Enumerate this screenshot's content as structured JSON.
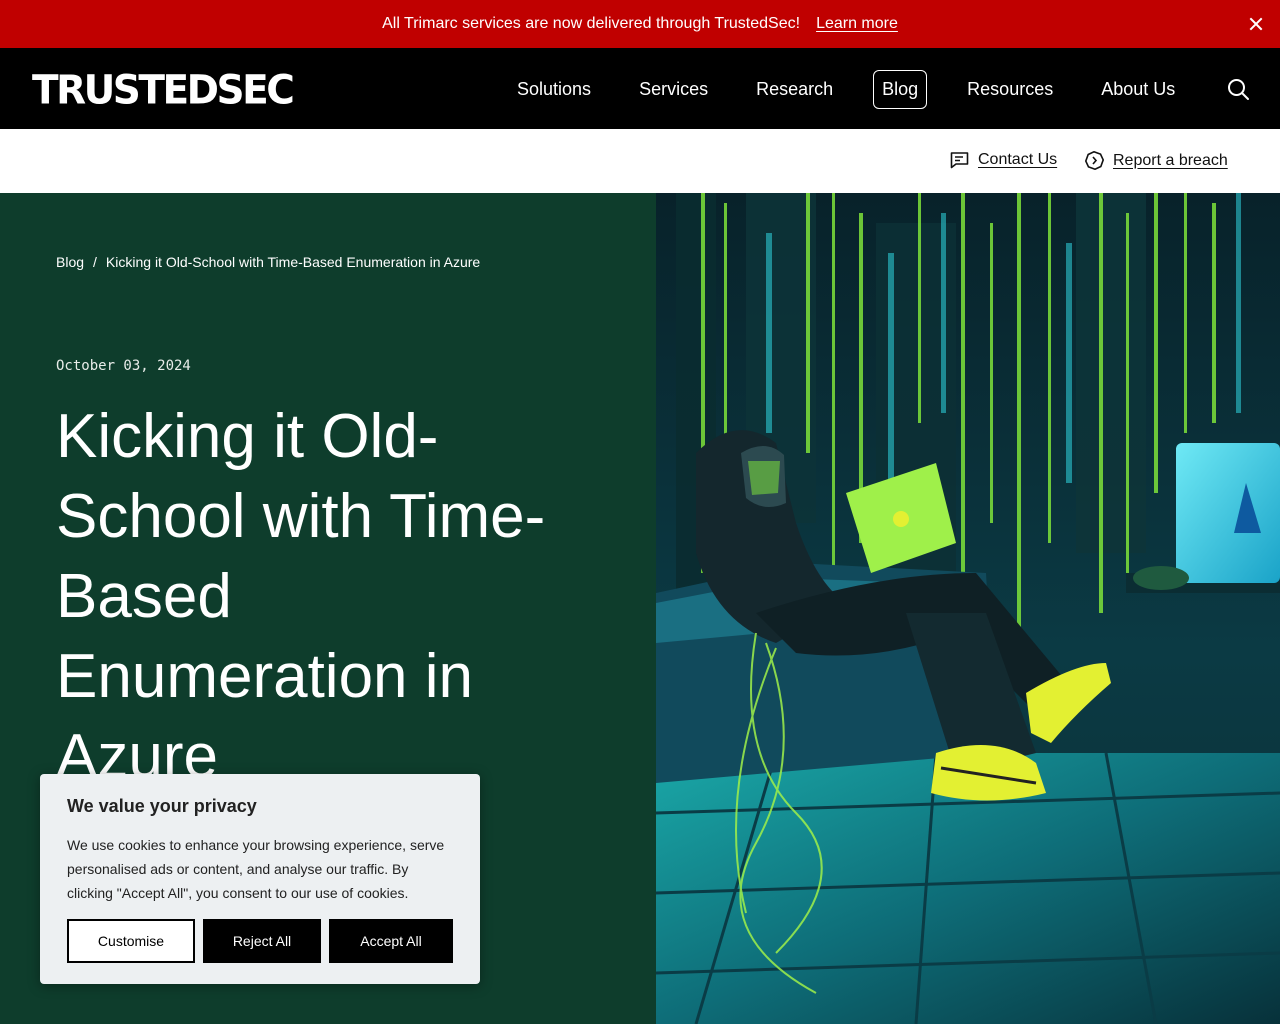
{
  "announcement": {
    "message": "All Trimarc services are now delivered through TrustedSec!",
    "link_label": "Learn more"
  },
  "header": {
    "logo_text": "TRUSTEDSEC",
    "nav": [
      "Solutions",
      "Services",
      "Research",
      "Blog",
      "Resources",
      "About Us"
    ],
    "active_nav": "Blog"
  },
  "subbar": {
    "contact_label": "Contact Us",
    "breach_label": "Report a breach"
  },
  "hero": {
    "breadcrumb_root": "Blog",
    "breadcrumb_sep": "/",
    "breadcrumb_current": "Kicking it Old-School with Time-Based Enumeration in Azure",
    "date": "October 03, 2024",
    "title": "Kicking it Old-School with Time-Based Enumeration in Azure"
  },
  "cookie": {
    "heading": "We value your privacy",
    "body": "We use cookies to enhance your browsing experience, serve personalised ads or content, and analyse our traffic. By clicking \"Accept All\", you consent to our use of cookies.",
    "customise_label": "Customise",
    "reject_label": "Reject All",
    "accept_label": "Accept All"
  },
  "colors": {
    "announcement_bg": "#c00000",
    "nav_bg": "#000000",
    "hero_bg": "#0e3d2c",
    "accent_yellow": "#e3f032",
    "accent_cyan": "#2fd6e0"
  }
}
